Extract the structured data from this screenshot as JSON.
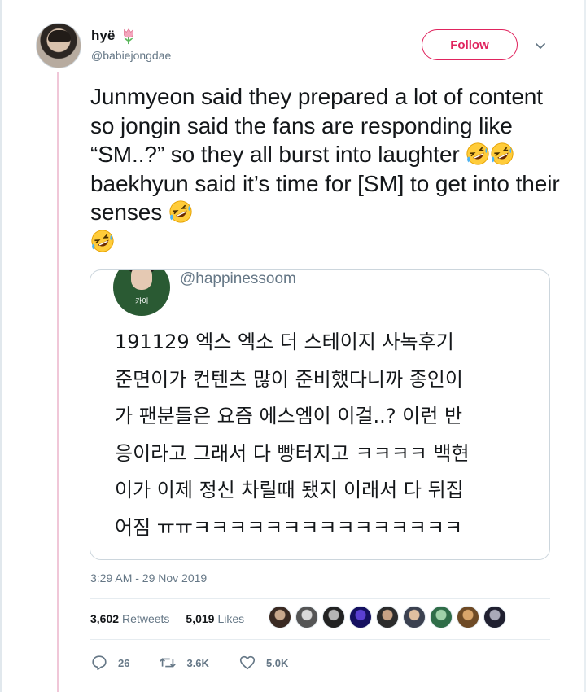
{
  "author": {
    "name": "hyë",
    "handle": "@babiejongdae"
  },
  "follow_label": "Follow",
  "tweet": {
    "text_parts": [
      "Junmyeon said they prepared a lot of content so jongin said the fans are responding like “SM..?” so they all burst into laughter ",
      " baekhyun said it’s time for [SM] to get into their senses "
    ]
  },
  "quote": {
    "handle": "@happinessoom",
    "avatar_tag": "카이",
    "text": "191129 엑스 엑소 더 스테이지 사녹후기\n준면이가 컨텐츠 많이 준비했다니까 종인이\n가 팬분들은 요즘 에스엠이 이걸..? 이런 반\n응이라고 그래서 다 빵터지고 ㅋㅋㅋㅋ 백현\n이가 이제 정신 차릴때 됐지 이래서 다 뒤집\n어짐 ㅠㅠㅋㅋㅋㅋㅋㅋㅋㅋㅋㅋㅋㅋㅋㅋㅋ"
  },
  "timestamp": "3:29 AM - 29 Nov 2019",
  "stats": {
    "retweets_count": "3,602",
    "retweets_label": "Retweets",
    "likes_count": "5,019",
    "likes_label": "Likes"
  },
  "actions": {
    "replies": "26",
    "retweets": "3.6K",
    "likes": "5.0K"
  },
  "colors": {
    "accent": "#e0245e",
    "secondary_text": "#657786",
    "border": "#ccd6dd",
    "thread_line": "#f0c7d8"
  },
  "icons": [
    "tulip-icon",
    "chevron-down-icon",
    "rofl-emoji",
    "reply-icon",
    "retweet-icon",
    "heart-icon"
  ]
}
